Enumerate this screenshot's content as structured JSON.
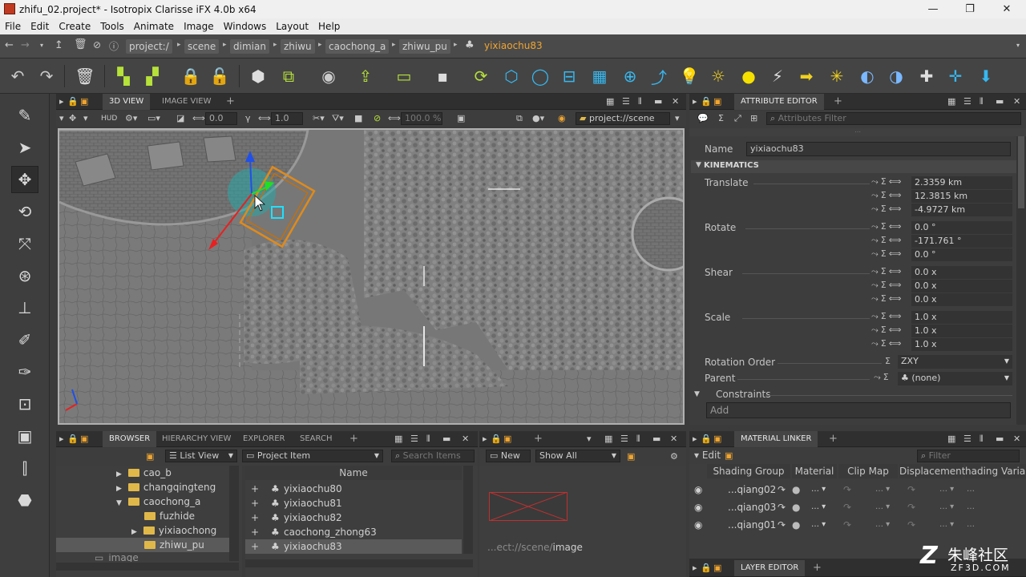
{
  "window": {
    "title": "zhifu_02.project* - Isotropix Clarisse iFX 4.0b x64",
    "min": "—",
    "max": "❐",
    "close": "✕"
  },
  "menu": [
    "File",
    "Edit",
    "Create",
    "Tools",
    "Animate",
    "Image",
    "Windows",
    "Layout",
    "Help"
  ],
  "breadcrumb": [
    "project:/",
    "scene",
    "dimian",
    "zhiwu",
    "caochong_a",
    "zhiwu_pu",
    "yixiaochu83"
  ],
  "viewport_panel": {
    "tabs": [
      "3D VIEW",
      "IMAGE VIEW"
    ],
    "add": "+",
    "hud": "HUD",
    "zero": "0.0",
    "one": "1.0",
    "pct": "100.0 %",
    "scene_path": "project://scene"
  },
  "attribute_editor": {
    "tab": "ATTRIBUTE EDITOR",
    "add": "+",
    "filter_placeholder": "Attributes Filter",
    "name_label": "Name",
    "name_value": "yixiaochu83",
    "section": "KINEMATICS",
    "translate_label": "Translate",
    "translate": [
      "2.3359 km",
      "12.3815 km",
      "-4.9727 km"
    ],
    "rotate_label": "Rotate",
    "rotate": [
      "0.0 °",
      "-171.761 °",
      "0.0 °"
    ],
    "shear_label": "Shear",
    "shear": [
      "0.0 x",
      "0.0 x",
      "0.0 x"
    ],
    "scale_label": "Scale",
    "scale": [
      "1.0 x",
      "1.0 x",
      "1.0 x"
    ],
    "rotation_order_label": "Rotation Order",
    "rotation_order": "ZXY",
    "parent_label": "Parent",
    "parent": "(none)",
    "constraints_label": "Constraints",
    "add_label": "Add"
  },
  "browser": {
    "tabs": [
      "BROWSER",
      "HIERARCHY VIEW",
      "EXPLORER",
      "SEARCH"
    ],
    "add": "+",
    "list_view": "List View",
    "project_item": "Project Item",
    "search_placeholder": "Search Items",
    "column_name": "Name",
    "tree": [
      {
        "label": "cao_b"
      },
      {
        "label": "changqingteng"
      },
      {
        "label": "caochong_a"
      },
      {
        "label": "fuzhide"
      },
      {
        "label": "yixiaochong"
      },
      {
        "label": "zhiwu_pu"
      },
      {
        "label": "image"
      }
    ],
    "items": [
      "yixiaochu80",
      "yixiaochu81",
      "yixiaochu82",
      "caochong_zhong63",
      "yixiaochu83"
    ]
  },
  "image_panel": {
    "add": "+",
    "new": "New",
    "show_all": "Show All",
    "path_prefix": "...ect://scene/",
    "path_suffix": "image"
  },
  "material_linker": {
    "tab": "MATERIAL LINKER",
    "add": "+",
    "edit": "Edit",
    "filter_placeholder": "Filter",
    "columns": [
      "Shading Group",
      "Material",
      "Clip Map",
      "Displacement",
      "hading Variabl"
    ],
    "rows": [
      "...qiang02",
      "...qiang03",
      "...qiang01"
    ]
  },
  "layer_editor": {
    "tab": "LAYER EDITOR",
    "add": "+"
  },
  "watermark": {
    "title": "朱峰社区",
    "sub": "ZF3D.COM"
  }
}
